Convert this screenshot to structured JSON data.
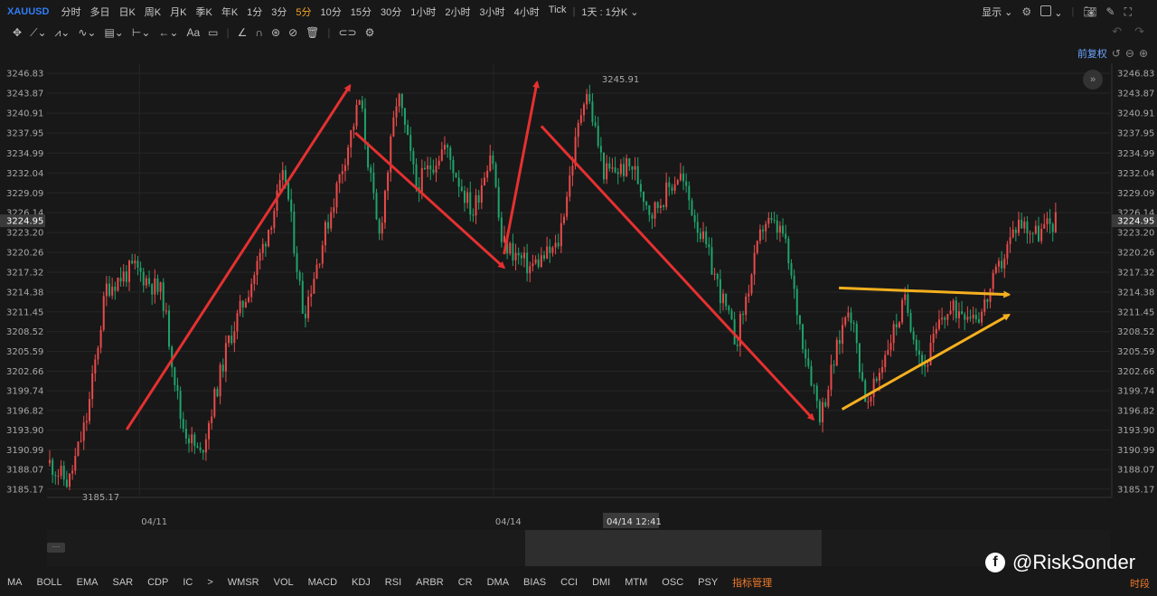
{
  "toolbar": {
    "symbol": "XAUUSD",
    "timeframes": [
      {
        "label": "分时",
        "active": false
      },
      {
        "label": "多日",
        "active": false
      },
      {
        "label": "日K",
        "active": false
      },
      {
        "label": "周K",
        "active": false
      },
      {
        "label": "月K",
        "active": false
      },
      {
        "label": "季K",
        "active": false
      },
      {
        "label": "年K",
        "active": false
      },
      {
        "label": "1分",
        "active": false
      },
      {
        "label": "3分",
        "active": false
      },
      {
        "label": "5分",
        "active": true
      },
      {
        "label": "10分",
        "active": false
      },
      {
        "label": "15分",
        "active": false
      },
      {
        "label": "30分",
        "active": false
      },
      {
        "label": "1小时",
        "active": false
      },
      {
        "label": "2小时",
        "active": false
      },
      {
        "label": "3小时",
        "active": false
      },
      {
        "label": "4小时",
        "active": false
      },
      {
        "label": "Tick",
        "active": false
      }
    ],
    "period_select": "1天 : 1分K",
    "display_label": "显示",
    "active_color": "#f5a623"
  },
  "drawing_tools": [
    "move-icon",
    "line-icon",
    "channel-icon",
    "wave-icon",
    "fib-icon",
    "measure-icon",
    "arrow-icon",
    "text-icon",
    "note-icon",
    "pencil-icon",
    "magnet-icon",
    "hide-icon",
    "lock-icon",
    "trash-icon",
    "toggle-icon",
    "settings-icon"
  ],
  "restore_label": "前复权",
  "chart_data": {
    "type": "candlestick",
    "symbol": "XAUUSD",
    "interval": "5分",
    "y_ticks": [
      3246.83,
      3243.87,
      3240.91,
      3237.95,
      3234.99,
      3232.04,
      3229.09,
      3226.14,
      3223.2,
      3220.26,
      3217.32,
      3214.38,
      3211.45,
      3208.52,
      3205.59,
      3202.66,
      3199.74,
      3196.82,
      3193.9,
      3190.99,
      3188.07,
      3185.17
    ],
    "ylim": [
      3184.2,
      3248.3
    ],
    "last_price": "3224.95",
    "last_price_value": 3224.95,
    "high_label": "3245.91",
    "high_value": 3245.91,
    "low_label": "3185.17",
    "low_value": 3185.17,
    "x_labels": [
      "04/11",
      "04/14"
    ],
    "crosshair_time": "04/14 12:41",
    "grid": true,
    "up_color": "#e84a4a",
    "down_color": "#1fa36b",
    "approx_price_path": [
      [
        0,
        3189
      ],
      [
        0.02,
        3186
      ],
      [
        0.04,
        3196
      ],
      [
        0.06,
        3215
      ],
      [
        0.09,
        3218
      ],
      [
        0.12,
        3214
      ],
      [
        0.14,
        3195
      ],
      [
        0.16,
        3190
      ],
      [
        0.19,
        3207
      ],
      [
        0.22,
        3218
      ],
      [
        0.25,
        3232
      ],
      [
        0.27,
        3211
      ],
      [
        0.3,
        3227
      ],
      [
        0.33,
        3243
      ],
      [
        0.35,
        3222
      ],
      [
        0.37,
        3244
      ],
      [
        0.39,
        3230
      ],
      [
        0.42,
        3236
      ],
      [
        0.45,
        3226
      ],
      [
        0.47,
        3236
      ],
      [
        0.48,
        3222
      ],
      [
        0.51,
        3218
      ],
      [
        0.54,
        3221
      ],
      [
        0.55,
        3229
      ],
      [
        0.57,
        3245
      ],
      [
        0.59,
        3232
      ],
      [
        0.62,
        3233
      ],
      [
        0.64,
        3226
      ],
      [
        0.67,
        3232
      ],
      [
        0.7,
        3220
      ],
      [
        0.73,
        3207
      ],
      [
        0.76,
        3225
      ],
      [
        0.78,
        3223
      ],
      [
        0.8,
        3208
      ],
      [
        0.82,
        3196
      ],
      [
        0.85,
        3213
      ],
      [
        0.87,
        3197
      ],
      [
        0.89,
        3206
      ],
      [
        0.91,
        3213
      ],
      [
        0.93,
        3203
      ],
      [
        0.95,
        3211
      ],
      [
        0.97,
        3212
      ],
      [
        0.99,
        3211
      ],
      [
        1.01,
        3218
      ],
      [
        1.03,
        3225
      ],
      [
        1.05,
        3223
      ],
      [
        1.07,
        3225
      ]
    ]
  },
  "annotations": [
    {
      "color": "#e63030",
      "from": [
        0.075,
        3194
      ],
      "to": [
        0.285,
        3245
      ]
    },
    {
      "color": "#e63030",
      "from": [
        0.29,
        3238
      ],
      "to": [
        0.43,
        3218
      ]
    },
    {
      "color": "#e63030",
      "from": [
        0.43,
        3220
      ],
      "to": [
        0.461,
        3245.5
      ]
    },
    {
      "color": "#e63030",
      "from": [
        0.465,
        3239
      ],
      "to": [
        0.721,
        3195.5
      ]
    },
    {
      "color": "#f5b01e",
      "from": [
        0.745,
        3215
      ],
      "to": [
        0.905,
        3214
      ]
    },
    {
      "color": "#f5b01e",
      "from": [
        0.748,
        3197
      ],
      "to": [
        0.905,
        3211
      ]
    }
  ],
  "indicators": [
    "MA",
    "BOLL",
    "EMA",
    "SAR",
    "CDP",
    "IC",
    ">",
    "WMSR",
    "VOL",
    "MACD",
    "KDJ",
    "RSI",
    "ARBR",
    "CR",
    "DMA",
    "BIAS",
    "CCI",
    "DMI",
    "MTM",
    "OSC",
    "PSY",
    "指标管理"
  ],
  "watermark": "@RiskSonder",
  "timezone_label": "时段"
}
